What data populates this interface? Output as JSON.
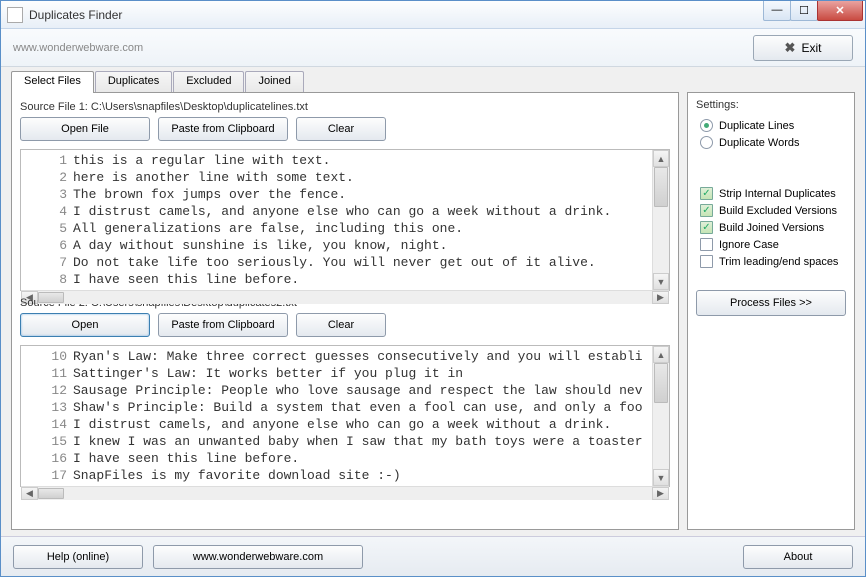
{
  "window": {
    "title": "Duplicates Finder"
  },
  "toolbar": {
    "url": "www.wonderwebware.com",
    "exit": "Exit"
  },
  "tabs": [
    "Select Files",
    "Duplicates",
    "Excluded",
    "Joined"
  ],
  "source1": {
    "label": "Source File 1: C:\\Users\\snapfiles\\Desktop\\duplicatelines.txt",
    "open": "Open File",
    "paste": "Paste from Clipboard",
    "clear": "Clear",
    "start": 1,
    "lines": [
      "this is a regular line with text.",
      "here is another line with some text.",
      "The brown fox jumps over the fence.",
      "I distrust camels, and anyone else who can go a week without a drink.",
      "All generalizations are false, including this one.",
      "A day without sunshine is like, you know, night.",
      "Do not take life too seriously. You will never get out of it alive.",
      "I have seen this line before."
    ]
  },
  "source2": {
    "label": "Source File 2: C:\\Users\\snapfiles\\Desktop\\duplicates2.txt",
    "open": "Open",
    "paste": "Paste from Clipboard",
    "clear": "Clear",
    "start": 10,
    "lines": [
      "Ryan's Law: Make three correct guesses consecutively and you will establi",
      "Sattinger's Law: It works better if you plug it in",
      "Sausage Principle: People who love sausage and respect the law should nev",
      "Shaw's Principle: Build a system that even a fool can use, and only a foo",
      "I distrust camels, and anyone else who can go a week without a drink.",
      "I knew I was an unwanted baby when I saw that my bath toys were a toaster",
      "I have seen this line before.",
      "SnapFiles is my favorite download site :-)"
    ]
  },
  "settings": {
    "title": "Settings:",
    "mode": {
      "lines": "Duplicate Lines",
      "words": "Duplicate Words",
      "selected": "lines"
    },
    "options": [
      {
        "label": "Strip Internal Duplicates",
        "checked": true
      },
      {
        "label": "Build Excluded Versions",
        "checked": true
      },
      {
        "label": "Build Joined Versions",
        "checked": true
      },
      {
        "label": "Ignore Case",
        "checked": false
      },
      {
        "label": "Trim leading/end spaces",
        "checked": false
      }
    ],
    "process": "Process Files  >>"
  },
  "footer": {
    "help": "Help (online)",
    "site": "www.wonderwebware.com",
    "about": "About"
  }
}
